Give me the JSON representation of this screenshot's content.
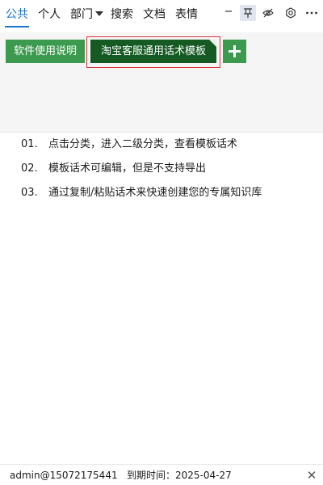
{
  "top_tabs": [
    {
      "label": "公共",
      "active": true
    },
    {
      "label": "个人",
      "active": false
    },
    {
      "label": "部门",
      "active": false,
      "dropdown": true
    },
    {
      "label": "搜索",
      "active": false
    },
    {
      "label": "文档",
      "active": false
    },
    {
      "label": "表情",
      "active": false
    }
  ],
  "toolbar_icons": [
    "minimize-icon",
    "pin-icon",
    "eye-off-icon",
    "settings-icon",
    "more-icon"
  ],
  "categories": [
    {
      "label": "软件使用说明",
      "color": "#3c9a4e",
      "selected": false
    },
    {
      "label": "淘宝客服通用话术模板",
      "color": "#155a22",
      "selected": true
    }
  ],
  "add_category_label": "+",
  "tips": [
    {
      "num": "01.",
      "text": "点击分类，进入二级分类，查看模板话术"
    },
    {
      "num": "02.",
      "text": "模板话术可编辑，但是不支持导出"
    },
    {
      "num": "03.",
      "text": "通过复制/粘贴话术来快速创建您的专属知识库"
    }
  ],
  "status": {
    "text": "admin@15072175441   到期时间：2025-04-27",
    "close": "✕"
  },
  "colors": {
    "accent": "#1a73c8",
    "category_green": "#3c9a4e",
    "category_dark_green": "#155a22",
    "selection_outline": "#d9363e"
  }
}
